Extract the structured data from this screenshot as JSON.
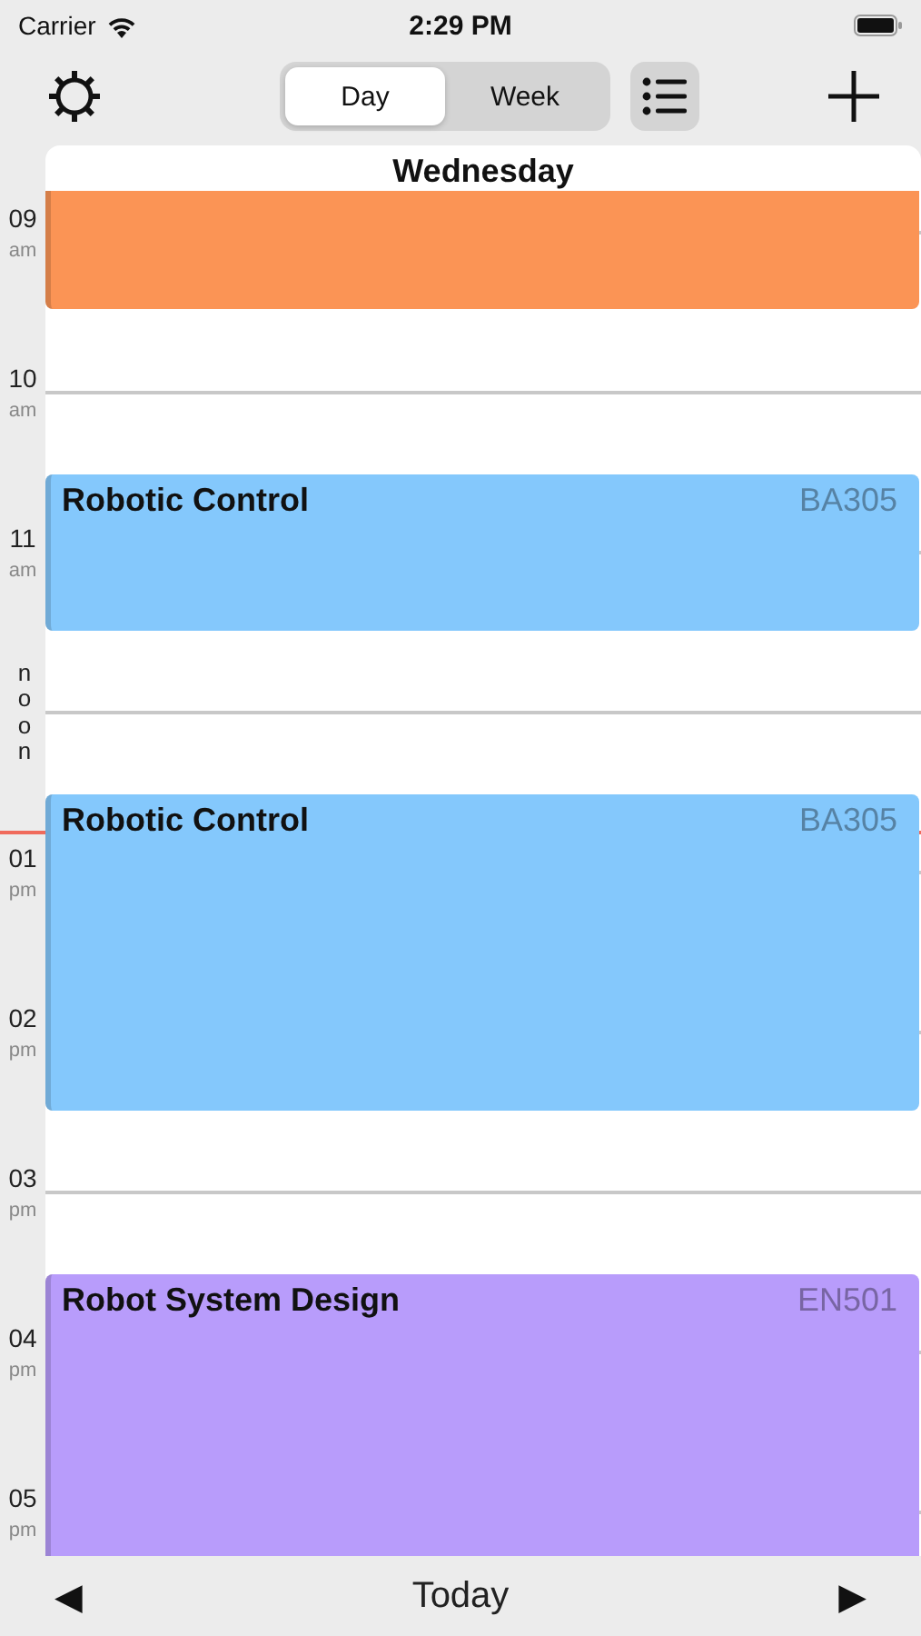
{
  "status_bar": {
    "carrier": "Carrier",
    "time": "2:29 PM"
  },
  "toolbar": {
    "segments": [
      {
        "label": "Day",
        "selected": true
      },
      {
        "label": "Week",
        "selected": false
      }
    ]
  },
  "day_header": "Wednesday",
  "hours": [
    {
      "kind": "hour",
      "hour": "09",
      "period": "am"
    },
    {
      "kind": "hour",
      "hour": "10",
      "period": "am"
    },
    {
      "kind": "hour",
      "hour": "11",
      "period": "am"
    },
    {
      "kind": "noon",
      "hour": "noon"
    },
    {
      "kind": "hour",
      "hour": "01",
      "period": "pm"
    },
    {
      "kind": "hour",
      "hour": "02",
      "period": "pm"
    },
    {
      "kind": "hour",
      "hour": "03",
      "period": "pm"
    },
    {
      "kind": "hour",
      "hour": "04",
      "period": "pm"
    },
    {
      "kind": "hour",
      "hour": "05",
      "period": "pm"
    }
  ],
  "events": [
    {
      "color": "#fb9455"
    },
    {
      "title": "Robotic Control",
      "room": "BA305",
      "color": "#84c8fc"
    },
    {
      "title": "Robotic Control",
      "room": "BA305",
      "color": "#84c8fc"
    },
    {
      "title": "Robot System Design",
      "room": "EN501",
      "color": "#b89cfb"
    }
  ],
  "bottom_bar": {
    "prev": "◀",
    "today": "Today",
    "next": "▶"
  }
}
